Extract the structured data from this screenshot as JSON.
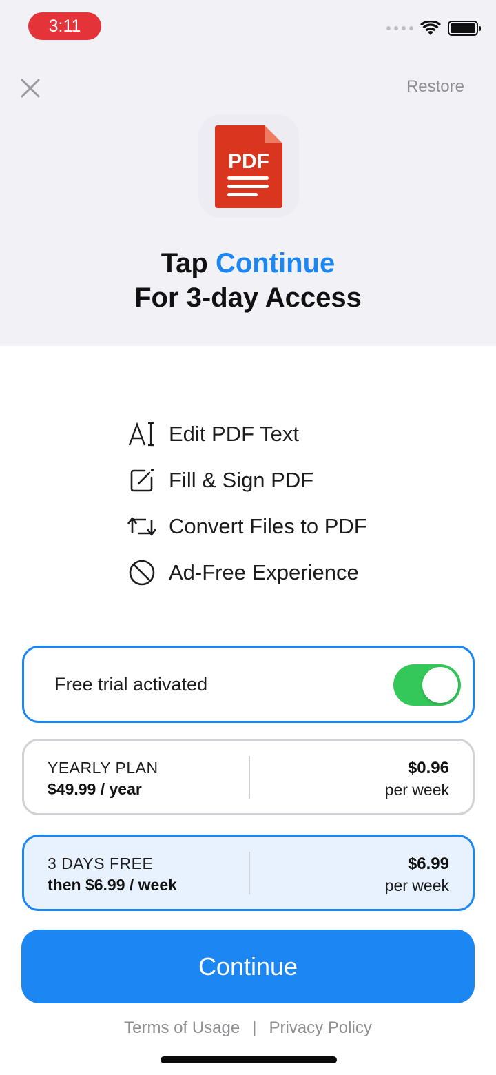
{
  "status_bar": {
    "time": "3:11",
    "accent_color": "#e5333a"
  },
  "header": {
    "close_icon": "close-icon",
    "restore_label": "Restore",
    "app_icon_text": "PDF"
  },
  "headline": {
    "line1_prefix": "Tap ",
    "line1_accent": "Continue",
    "line2": "For 3-day Access"
  },
  "features": [
    {
      "icon": "text-cursor-icon",
      "label": "Edit PDF Text"
    },
    {
      "icon": "edit-square-icon",
      "label": "Fill & Sign PDF"
    },
    {
      "icon": "convert-arrows-icon",
      "label": "Convert Files to PDF"
    },
    {
      "icon": "no-ads-icon",
      "label": "Ad-Free Experience"
    }
  ],
  "trial": {
    "label": "Free trial activated",
    "enabled": true
  },
  "plans": [
    {
      "name": "YEARLY PLAN",
      "price": "$49.99 / year",
      "amount": "$0.96",
      "per": "per week",
      "selected": false
    },
    {
      "name": "3 DAYS FREE",
      "price": "then $6.99 / week",
      "amount": "$6.99",
      "per": "per week",
      "selected": true
    }
  ],
  "cta": {
    "label": "Continue",
    "color": "#1c86f2"
  },
  "footer": {
    "terms": "Terms of Usage",
    "separator": "|",
    "privacy": "Privacy Policy"
  },
  "colors": {
    "accent": "#1c86f2",
    "toggle_on": "#34c759",
    "pdf_red": "#d9351f"
  }
}
